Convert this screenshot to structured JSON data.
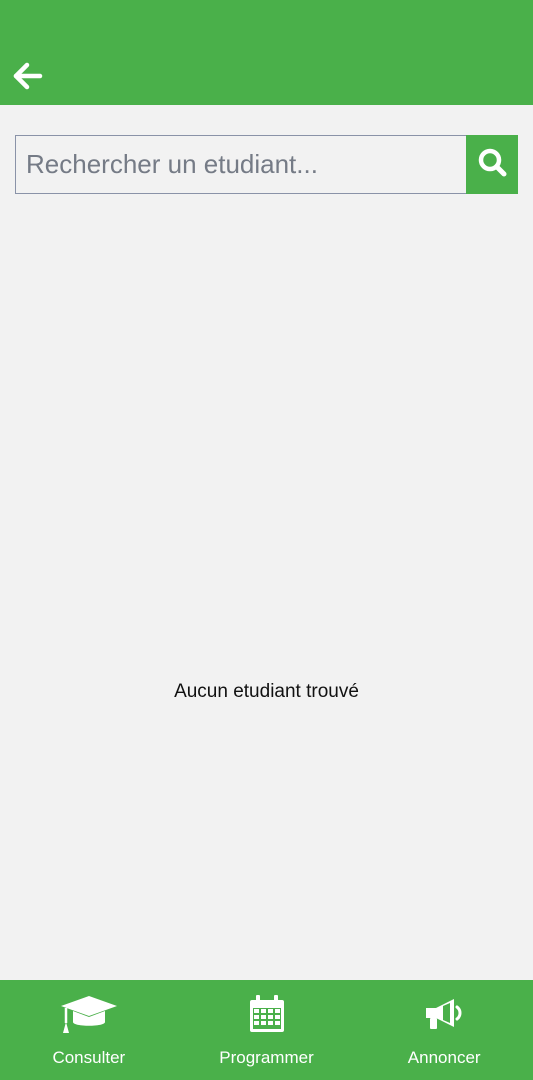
{
  "header": {
    "back_icon": "arrow-left-icon"
  },
  "search": {
    "placeholder": "Rechercher un etudiant...",
    "value": "",
    "button_icon": "search-icon"
  },
  "main": {
    "empty_message": "Aucun etudiant trouvé"
  },
  "bottom_nav": {
    "items": [
      {
        "label": "Consulter",
        "icon": "graduation-cap-icon"
      },
      {
        "label": "Programmer",
        "icon": "calendar-icon"
      },
      {
        "label": "Annoncer",
        "icon": "megaphone-icon"
      }
    ]
  },
  "colors": {
    "accent": "#4ab04a",
    "background": "#f2f2f2",
    "nav_text": "#ffffff"
  }
}
